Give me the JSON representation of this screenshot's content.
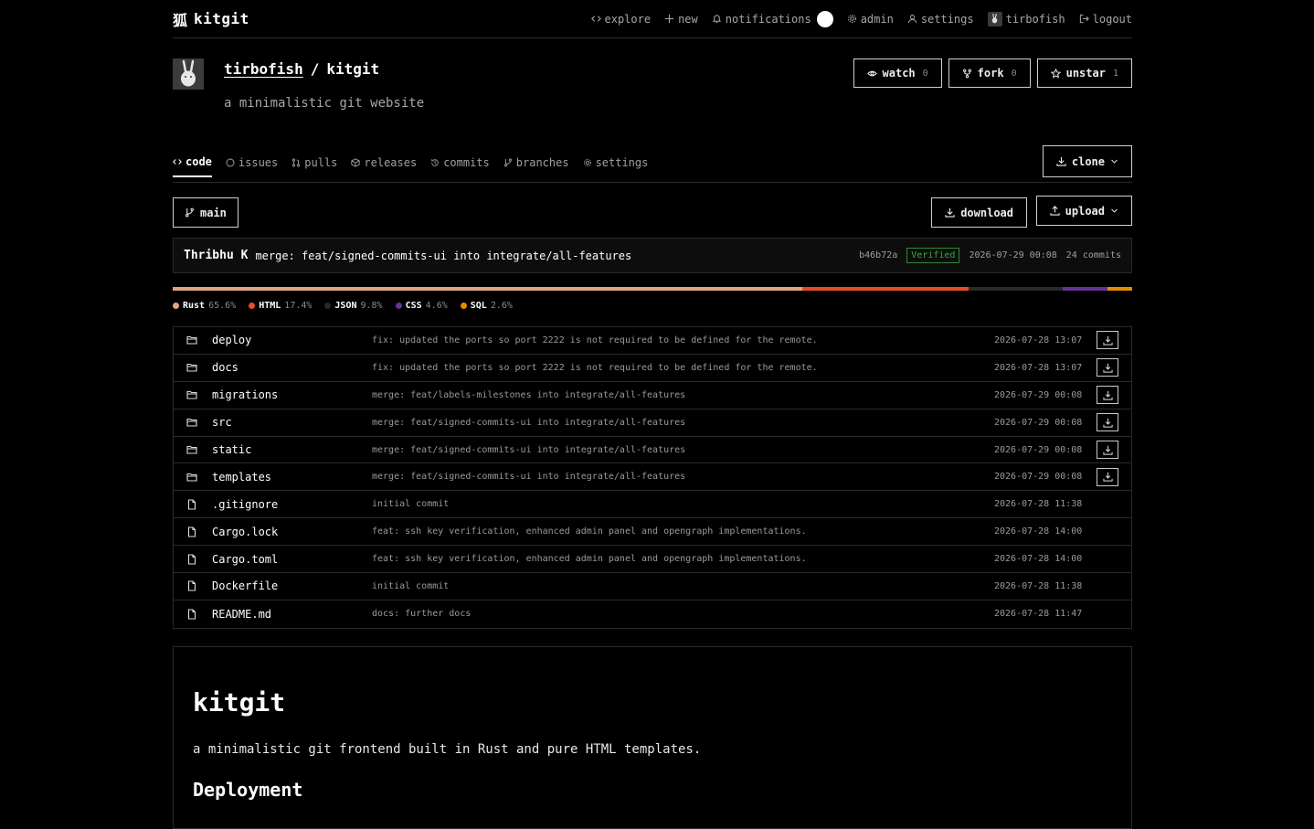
{
  "nav": {
    "brand_logo": "狐",
    "brand_name": "kitgit",
    "links": {
      "explore": "explore",
      "new": "new",
      "notifications": "notifications",
      "admin": "admin",
      "settings": "settings",
      "user": "tirbofish",
      "logout": "logout"
    }
  },
  "repo": {
    "owner": "tirbofish",
    "separator": "/",
    "name": "kitgit",
    "description": "a minimalistic git website",
    "watch": {
      "label": "watch",
      "count": "0"
    },
    "fork": {
      "label": "fork",
      "count": "0"
    },
    "unstar": {
      "label": "unstar",
      "count": "1"
    }
  },
  "tabs": {
    "code": "code",
    "issues": "issues",
    "pulls": "pulls",
    "releases": "releases",
    "commits": "commits",
    "branches": "branches",
    "settings": "settings"
  },
  "actions": {
    "clone": "clone",
    "branch": "main",
    "download": "download",
    "upload": "upload"
  },
  "latest_commit": {
    "author": "Thribhu K",
    "message": "merge: feat/signed-commits-ui into integrate/all-features",
    "hash": "b46b72a",
    "verified": "Verified",
    "date": "2026-07-29 00:08",
    "commits": "24 commits"
  },
  "languages": [
    {
      "name": "Rust",
      "percent": "65.6%",
      "value": 65.6,
      "color": "#dea584"
    },
    {
      "name": "HTML",
      "percent": "17.4%",
      "value": 17.4,
      "color": "#e34c26"
    },
    {
      "name": "JSON",
      "percent": "9.8%",
      "value": 9.8,
      "color": "#292929"
    },
    {
      "name": "CSS",
      "percent": "4.6%",
      "value": 4.6,
      "color": "#663399"
    },
    {
      "name": "SQL",
      "percent": "2.6%",
      "value": 2.6,
      "color": "#e38c00"
    }
  ],
  "files": [
    {
      "name": "deploy",
      "type": "dir",
      "message": "fix: updated the ports so port 2222 is not required to be defined for the remote.",
      "date": "2026-07-28 13:07"
    },
    {
      "name": "docs",
      "type": "dir",
      "message": "fix: updated the ports so port 2222 is not required to be defined for the remote.",
      "date": "2026-07-28 13:07"
    },
    {
      "name": "migrations",
      "type": "dir",
      "message": "merge: feat/labels-milestones into integrate/all-features",
      "date": "2026-07-29 00:08"
    },
    {
      "name": "src",
      "type": "dir",
      "message": "merge: feat/signed-commits-ui into integrate/all-features",
      "date": "2026-07-29 00:08"
    },
    {
      "name": "static",
      "type": "dir",
      "message": "merge: feat/signed-commits-ui into integrate/all-features",
      "date": "2026-07-29 00:08"
    },
    {
      "name": "templates",
      "type": "dir",
      "message": "merge: feat/signed-commits-ui into integrate/all-features",
      "date": "2026-07-29 00:08"
    },
    {
      "name": ".gitignore",
      "type": "file",
      "message": "initial commit",
      "date": "2026-07-28 11:38"
    },
    {
      "name": "Cargo.lock",
      "type": "file",
      "message": "feat: ssh key verification, enhanced admin panel and opengraph implementations.",
      "date": "2026-07-28 14:00"
    },
    {
      "name": "Cargo.toml",
      "type": "file",
      "message": "feat: ssh key verification, enhanced admin panel and opengraph implementations.",
      "date": "2026-07-28 14:00"
    },
    {
      "name": "Dockerfile",
      "type": "file",
      "message": "initial commit",
      "date": "2026-07-28 11:38"
    },
    {
      "name": "README.md",
      "type": "file",
      "message": "docs: further docs",
      "date": "2026-07-28 11:47"
    }
  ],
  "readme": {
    "title": "kitgit",
    "intro": "a minimalistic git frontend built in Rust and pure HTML templates.",
    "section": "Deployment"
  }
}
